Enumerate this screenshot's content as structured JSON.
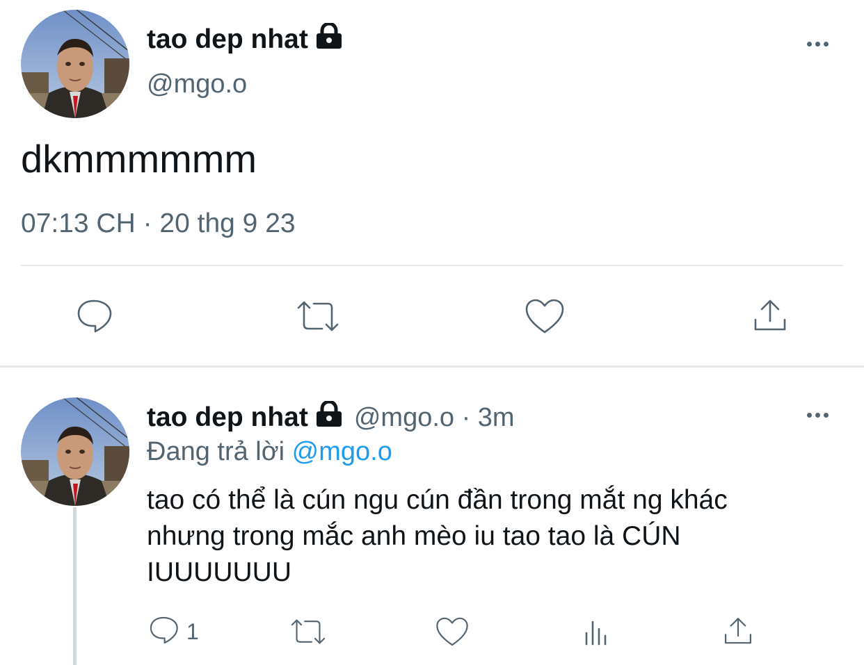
{
  "tweet": {
    "display_name": "tao dep nhat",
    "handle": "@mgo.o",
    "text": "dkmmmmmm",
    "timestamp": "07:13 CH · 20 thg 9 23",
    "avatar_icon": "avatar-photo",
    "lock_icon": "lock-icon",
    "more_icon": "more-icon",
    "actions": [
      "reply-icon",
      "retweet-icon",
      "like-icon",
      "share-icon"
    ]
  },
  "reply": {
    "display_name": "tao dep nhat",
    "handle_time": "@mgo.o · 3m",
    "replying_prefix": "Đang trả lời",
    "replying_to": "@mgo.o",
    "text_lines": [
      "tao có thể là cún ngu cún đần trong mắt ng khác",
      "nhưng trong mắc anh mèo iu tao tao là CÚN",
      "IUUUUUUU"
    ],
    "reply_count": "1",
    "actions": [
      "reply-icon",
      "retweet-icon",
      "like-icon",
      "views-icon",
      "share-icon"
    ]
  },
  "colors": {
    "text": "#0f1419",
    "secondary": "#536471",
    "link": "#1d9bf0",
    "divider": "#e6e9ec"
  }
}
